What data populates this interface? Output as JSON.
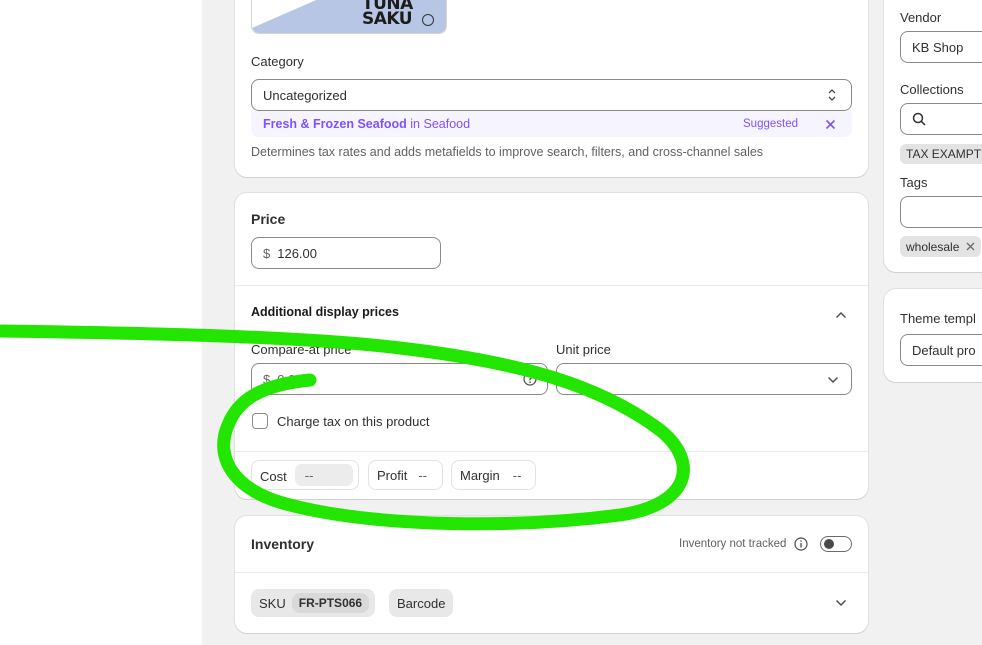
{
  "media": {
    "logo_line1": "PRIME TUNA",
    "logo_line2": "SAKU"
  },
  "category": {
    "label": "Category",
    "value": "Uncategorized",
    "suggestion_name": "Fresh & Frozen Seafood",
    "suggestion_in": "in",
    "suggestion_parent": "Seafood",
    "suggested_label": "Suggested",
    "help_text": "Determines tax rates and adds metafields to improve search, filters, and cross-channel sales"
  },
  "price": {
    "title": "Price",
    "currency": "$",
    "value": "126.00",
    "additional_title": "Additional display prices",
    "compare_label": "Compare-at price",
    "compare_value": "0.00",
    "unit_label": "Unit price",
    "unit_value": "--",
    "tax_label": "Charge tax on this product",
    "cost_label": "Cost",
    "cost_value": "--",
    "profit_label": "Profit",
    "profit_value": "--",
    "margin_label": "Margin",
    "margin_value": "--"
  },
  "inventory": {
    "title": "Inventory",
    "tracked_label": "Inventory not tracked",
    "sku_label": "SKU",
    "sku_value": "FR-PTS066",
    "barcode_label": "Barcode"
  },
  "organization": {
    "vendor_label": "Vendor",
    "vendor_value": "KB Shop",
    "collections_label": "Collections",
    "collection_tag": "TAX EXAMPT",
    "tags_label": "Tags",
    "tag": "wholesale"
  },
  "theme": {
    "label": "Theme templ",
    "value": "Default pro"
  },
  "colors": {
    "accent_purple": "#8051ff",
    "annotation_green": "#22e600"
  }
}
